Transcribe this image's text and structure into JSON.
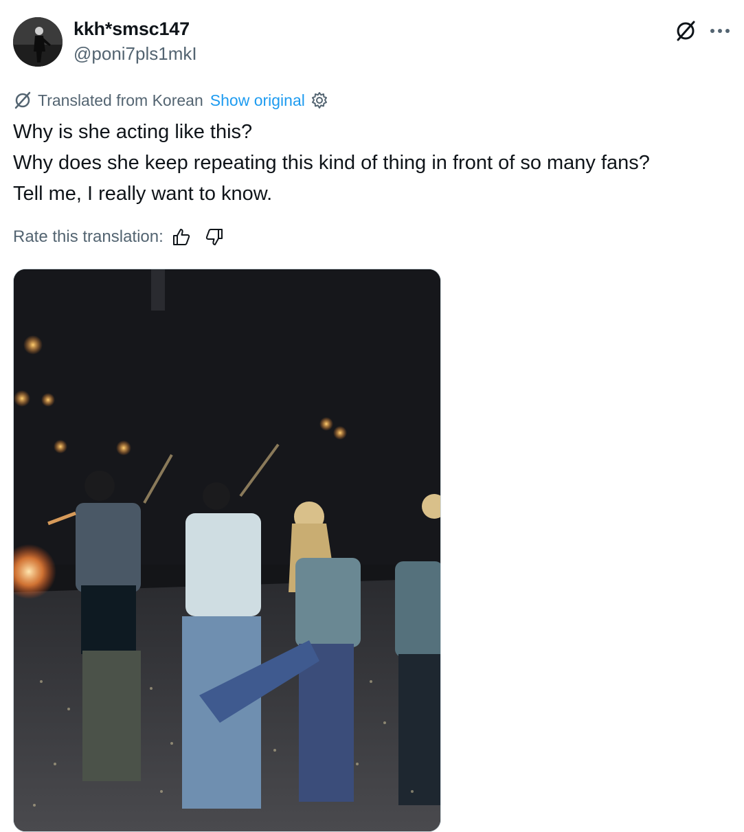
{
  "author": {
    "display_name": "kkh*smsc147",
    "handle": "@poni7pls1mkI"
  },
  "translation": {
    "label": "Translated from Korean",
    "show_original": "Show original"
  },
  "tweet": {
    "lines": [
      "Why is she acting like this?",
      "Why does she keep repeating this kind of thing in front of so many fans?",
      "Tell me, I really want to know."
    ]
  },
  "rate": {
    "label": "Rate this translation:"
  },
  "icons": {
    "translate": "translate-icon",
    "more": "more-icon",
    "settings": "gear-icon",
    "thumbs_up": "thumbs-up-icon",
    "thumbs_down": "thumbs-down-icon"
  },
  "colors": {
    "text": "#0f1419",
    "secondary": "#536471",
    "link": "#1d9bf0"
  }
}
